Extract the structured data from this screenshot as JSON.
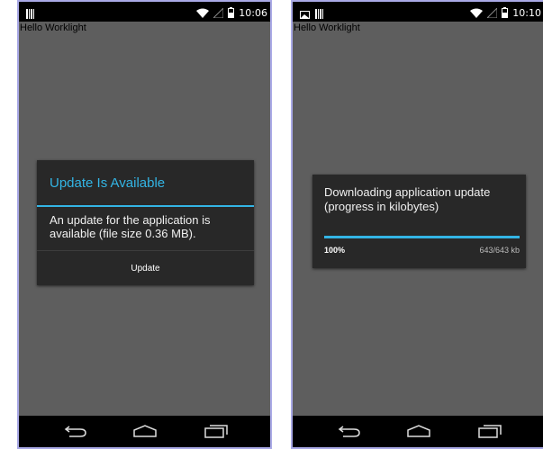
{
  "left": {
    "status_time": "10:06",
    "app_title": "Hello Worklight",
    "dialog": {
      "title": "Update Is Available",
      "message": "An update for the application is available (file size 0.36 MB).",
      "button_label": "Update"
    },
    "nav": {
      "back_icon": "back-icon",
      "home_icon": "home-icon",
      "recents_icon": "recents-icon"
    }
  },
  "right": {
    "status_time": "10:10",
    "app_title": "Hello Worklight",
    "dialog": {
      "message": "Downloading application update (progress in kilobytes)",
      "progress_percent": "100%",
      "progress_fraction": 1.0,
      "progress_count": "643/643 kb"
    },
    "nav": {
      "back_icon": "back-icon",
      "home_icon": "home-icon",
      "recents_icon": "recents-icon"
    }
  },
  "colors": {
    "accent": "#33b5e5",
    "screen_bg": "#5e5e5e",
    "dialog_bg": "#282828",
    "bars_bg": "#000000"
  }
}
